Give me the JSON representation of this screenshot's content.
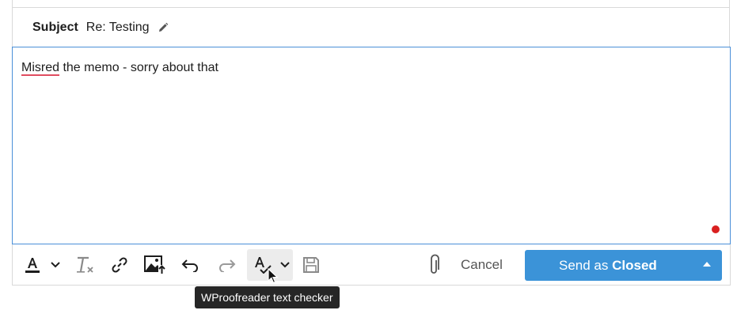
{
  "subject": {
    "label": "Subject",
    "value": "Re: Testing",
    "edit_icon": "pencil-icon"
  },
  "editor": {
    "misspelled_word": "Misred",
    "rest_text": " the memo - sorry about that",
    "status_color": "#d92020"
  },
  "toolbar": {
    "icons": [
      "font-color-icon",
      "chevron-down-icon",
      "clear-formatting-icon",
      "link-icon",
      "insert-image-icon",
      "undo-icon",
      "redo-icon",
      "spell-check-icon",
      "chevron-down-icon",
      "save-icon",
      "paperclip-icon"
    ],
    "cancel_label": "Cancel",
    "send_prefix": "Send as ",
    "send_status": "Closed",
    "send_color": "#3b93d8"
  },
  "tooltip": {
    "text": "WProofreader text checker"
  }
}
